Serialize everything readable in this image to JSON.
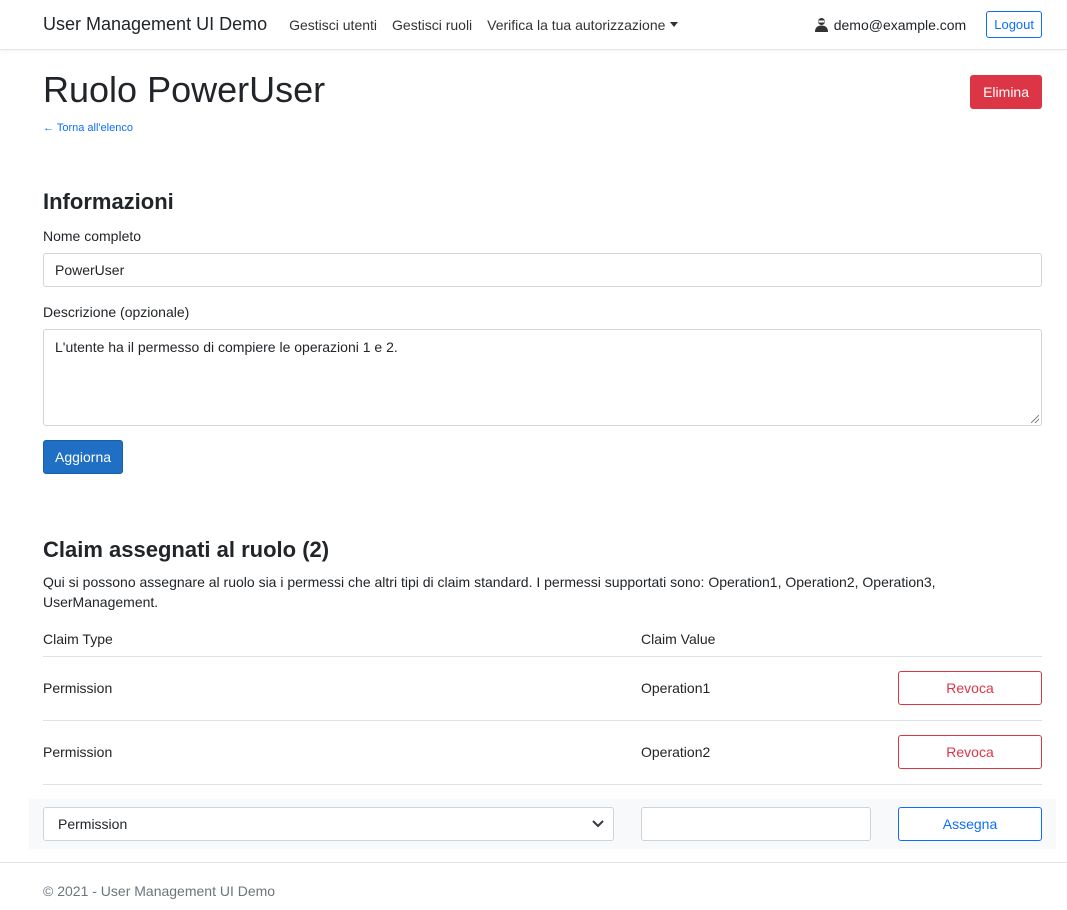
{
  "navbar": {
    "brand": "User Management UI Demo",
    "links": [
      "Gestisci utenti",
      "Gestisci ruoli",
      "Verifica la tua autorizzazione"
    ],
    "user_email": "demo@example.com",
    "logout_label": "Logout"
  },
  "page": {
    "title": "Ruolo PowerUser",
    "delete_label": "Elimina",
    "back_label": "← Torna all'elenco"
  },
  "info": {
    "heading": "Informazioni",
    "name_label": "Nome completo",
    "name_value": "PowerUser",
    "description_label": "Descrizione (opzionale)",
    "description_value": "L'utente ha il permesso di compiere le operazioni 1 e 2.",
    "update_label": "Aggiorna"
  },
  "claims": {
    "heading": "Claim assegnati al ruolo (2)",
    "help": "Qui si possono assegnare al ruolo sia i permessi che altri tipi di claim standard. I permessi supportati sono: Operation1, Operation2, Operation3, UserManagement.",
    "columns": [
      "Claim Type",
      "Claim Value"
    ],
    "rows": [
      {
        "type": "Permission",
        "value": "Operation1",
        "action": "Revoca"
      },
      {
        "type": "Permission",
        "value": "Operation2",
        "action": "Revoca"
      }
    ],
    "new_type_selected": "Permission",
    "new_value": "",
    "assign_label": "Assegna"
  },
  "footer": {
    "text": "© 2021 - User Management UI Demo"
  },
  "colors": {
    "primary": "#1f6fc5",
    "link": "#0d6efd",
    "danger": "#dc3545"
  }
}
